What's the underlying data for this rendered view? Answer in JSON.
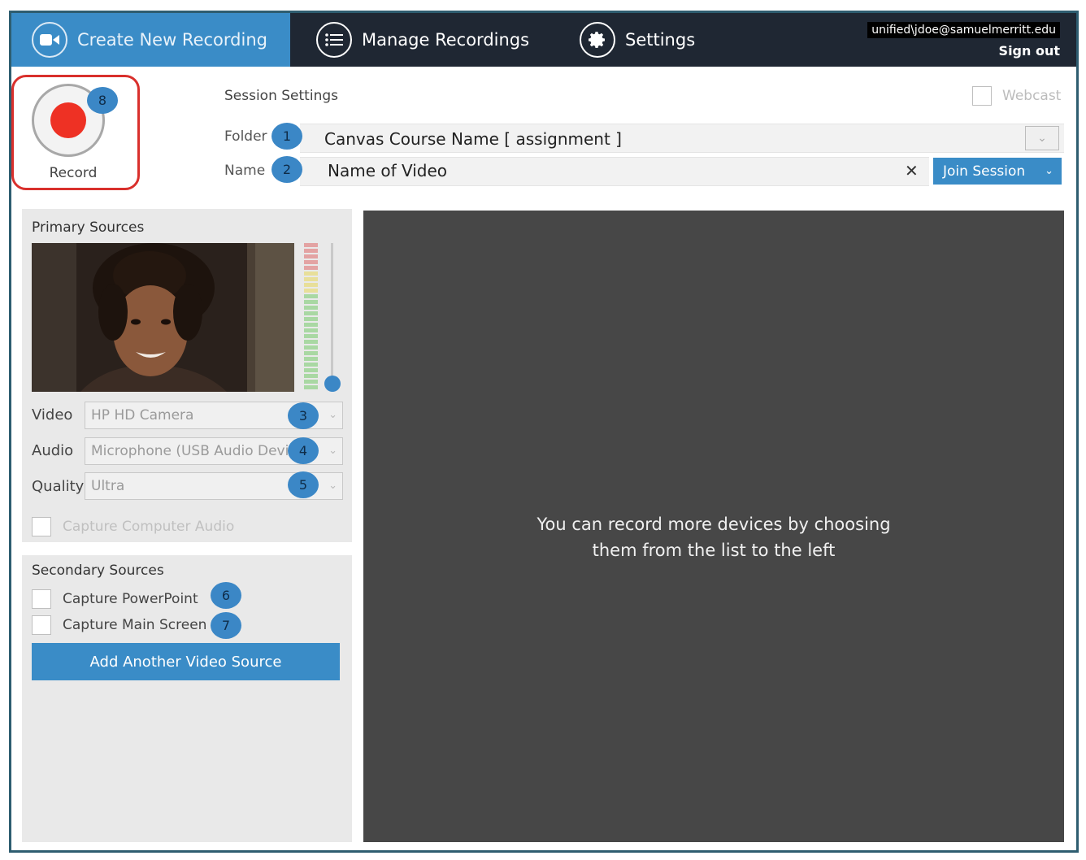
{
  "nav": {
    "tabs": [
      {
        "label": "Create New Recording",
        "icon": "video-camera-icon",
        "active": true
      },
      {
        "label": "Manage Recordings",
        "icon": "list-icon",
        "active": false
      },
      {
        "label": "Settings",
        "icon": "gear-icon",
        "active": false
      }
    ],
    "user_email": "unified\\jdoe@samuelmerritt.edu",
    "sign_out": "Sign out"
  },
  "record": {
    "label": "Record",
    "badge": "8"
  },
  "session": {
    "title": "Session Settings",
    "webcast_label": "Webcast",
    "folder_label": "Folder",
    "folder_value": "Canvas Course Name [ assignment ]",
    "folder_badge": "1",
    "name_label": "Name",
    "name_value": "Name of Video",
    "name_badge": "2",
    "join_label": "Join Session"
  },
  "primary": {
    "title": "Primary Sources",
    "video_label": "Video",
    "video_value": "HP HD Camera",
    "video_badge": "3",
    "audio_label": "Audio",
    "audio_value": "Microphone (USB Audio Device)",
    "audio_badge": "4",
    "quality_label": "Quality",
    "quality_value": "Ultra",
    "quality_badge": "5",
    "capture_audio_label": "Capture Computer Audio"
  },
  "secondary": {
    "title": "Secondary Sources",
    "ppt_label": "Capture PowerPoint",
    "ppt_badge": "6",
    "screen_label": "Capture Main Screen",
    "screen_badge": "7",
    "add_label": "Add Another Video Source"
  },
  "preview": {
    "line1": "You can record more devices by choosing",
    "line2": "them from the list to the left"
  },
  "colors": {
    "accent": "#3a8cc7",
    "nav_bg": "#1f2733",
    "record_red": "#ee3124",
    "highlight_border": "#d9302c"
  }
}
